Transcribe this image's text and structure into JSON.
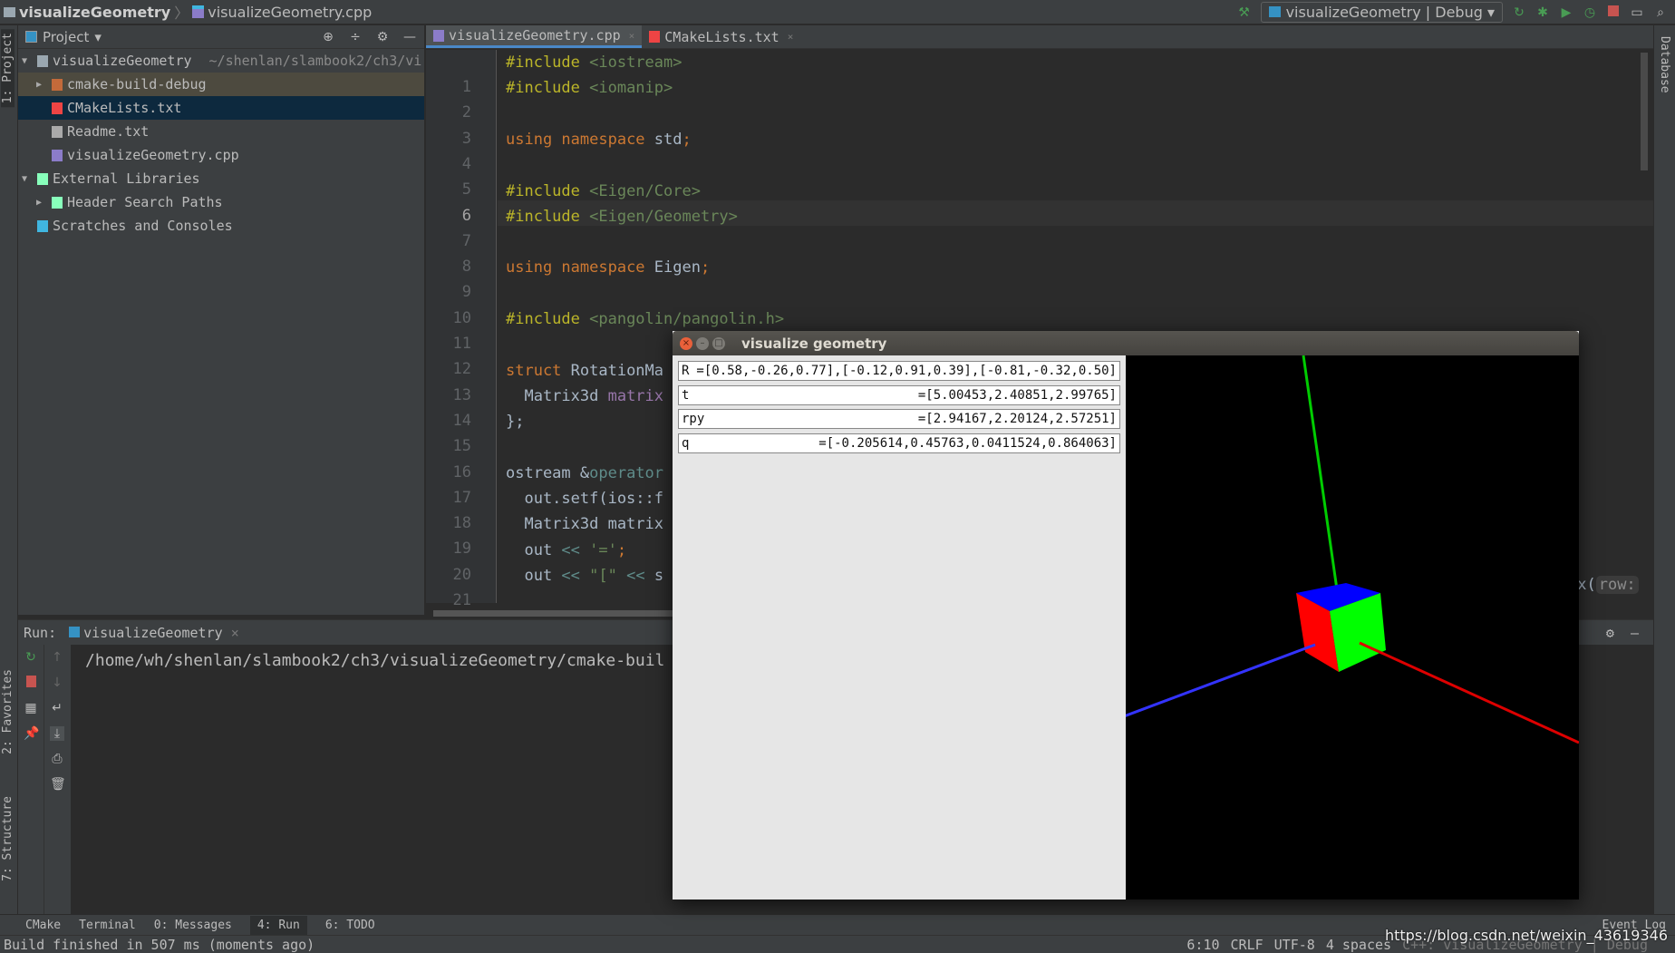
{
  "navbar": {
    "project": "visualizeGeometry",
    "file": "visualizeGeometry.cpp",
    "run_config": "visualizeGeometry | Debug"
  },
  "stripes": {
    "project": "1: Project",
    "favorites": "2: Favorites",
    "structure": "7: Structure",
    "database": "Database"
  },
  "project_panel": {
    "title": "Project",
    "tree": [
      {
        "label": "visualizeGeometry",
        "path": "~/shenlan/slambook2/ch3/vi",
        "indent": 0,
        "arrow": "▼",
        "icon": "folder-icon"
      },
      {
        "label": "cmake-build-debug",
        "indent": 1,
        "arrow": "▶",
        "icon": "folder-icon",
        "highlight": "build"
      },
      {
        "label": "CMakeLists.txt",
        "indent": 1,
        "icon": "cmake-icon",
        "highlight": "selected"
      },
      {
        "label": "Readme.txt",
        "indent": 1,
        "icon": "text-file-icon"
      },
      {
        "label": "visualizeGeometry.cpp",
        "indent": 1,
        "icon": "cpp-file-icon"
      },
      {
        "label": "External Libraries",
        "indent": 0,
        "arrow": "▼",
        "icon": "library-icon"
      },
      {
        "label": "Header Search Paths",
        "indent": 1,
        "arrow": "▶",
        "icon": "library-icon"
      },
      {
        "label": "Scratches and Consoles",
        "indent": 0,
        "icon": "scratches-icon"
      }
    ]
  },
  "editor": {
    "tabs": [
      {
        "label": "visualizeGeometry.cpp",
        "active": true
      },
      {
        "label": "CMakeLists.txt",
        "active": false
      }
    ],
    "current_line": 6,
    "lines": [
      [
        [
          "#include ",
          "inc"
        ],
        [
          "<iostream>",
          "str"
        ]
      ],
      [
        [
          "#include ",
          "inc"
        ],
        [
          "<iomanip>",
          "str"
        ]
      ],
      [],
      [
        [
          "using ",
          "kw"
        ],
        [
          "namespace ",
          "kw"
        ],
        [
          "std",
          ""
        ],
        [
          ";",
          "kw"
        ]
      ],
      [],
      [
        [
          "#include ",
          "inc"
        ],
        [
          "<Eigen/Core>",
          "str"
        ]
      ],
      [
        [
          "#include ",
          "inc"
        ],
        [
          "<Eigen/Geometry>",
          "str"
        ]
      ],
      [],
      [
        [
          "using ",
          "kw"
        ],
        [
          "namespace ",
          "kw"
        ],
        [
          "Eigen",
          ""
        ],
        [
          ";",
          "kw"
        ]
      ],
      [],
      [
        [
          "#include ",
          "inc"
        ],
        [
          "<pangolin/pangolin.h>",
          "str"
        ]
      ],
      [],
      [
        [
          "struct ",
          "kw"
        ],
        [
          "RotationMa",
          ""
        ]
      ],
      [
        [
          "  Matrix3d ",
          ""
        ],
        [
          "matrix",
          "mem"
        ]
      ],
      [
        [
          "};",
          ""
        ]
      ],
      [],
      [
        [
          "ostream &",
          ""
        ],
        [
          "operator",
          "op"
        ]
      ],
      [
        [
          "  out.setf(ios::f",
          ""
        ]
      ],
      [
        [
          "  Matrix3d matrix",
          ""
        ]
      ],
      [
        [
          "  out ",
          ""
        ],
        [
          "<< ",
          "op"
        ],
        [
          "'='",
          "str"
        ],
        [
          ";",
          "kw"
        ]
      ],
      [
        [
          "  out ",
          ""
        ],
        [
          "<< ",
          "op"
        ],
        [
          "\"[\" ",
          "str"
        ],
        [
          "<< ",
          "op"
        ],
        [
          "s",
          ""
        ]
      ]
    ],
    "line21_tail": "ix(",
    "line21_hint": "row:"
  },
  "run": {
    "label": "Run:",
    "config": "visualizeGeometry",
    "output": "/home/wh/shenlan/slambook2/ch3/visualizeGeometry/cmake-buil"
  },
  "bottom_tabs": [
    "CMake",
    "Terminal",
    "0: Messages",
    "4: Run",
    "6: TODO"
  ],
  "event_log": "Event Log",
  "status": {
    "message": "Build finished in 507 ms (moments ago)",
    "position": "6:10",
    "line_sep": "CRLF",
    "encoding": "UTF-8",
    "indent": "4 spaces",
    "context": "C++: visualizeGeometry | Debug"
  },
  "watermark": "https://blog.csdn.net/weixin_43619346",
  "viewer": {
    "title": "visualize geometry",
    "rows": [
      {
        "label": "R",
        "value": "=[0.58,-0.26,0.77],[-0.12,0.91,0.39],[-0.81,-0.32,0.50]"
      },
      {
        "label": "t",
        "value": "=[5.00453,2.40851,2.99765]"
      },
      {
        "label": "rpy",
        "value": "=[2.94167,2.20124,2.57251]"
      },
      {
        "label": "q",
        "value": "=[-0.205614,0.45763,0.0411524,0.864063]"
      }
    ],
    "colors": {
      "x_axis": "#dd0000",
      "y_axis": "#00cc00",
      "z_axis": "#3333ff",
      "face_top": "#0000ff",
      "face_left": "#ff0000",
      "face_front": "#00ff00"
    }
  }
}
